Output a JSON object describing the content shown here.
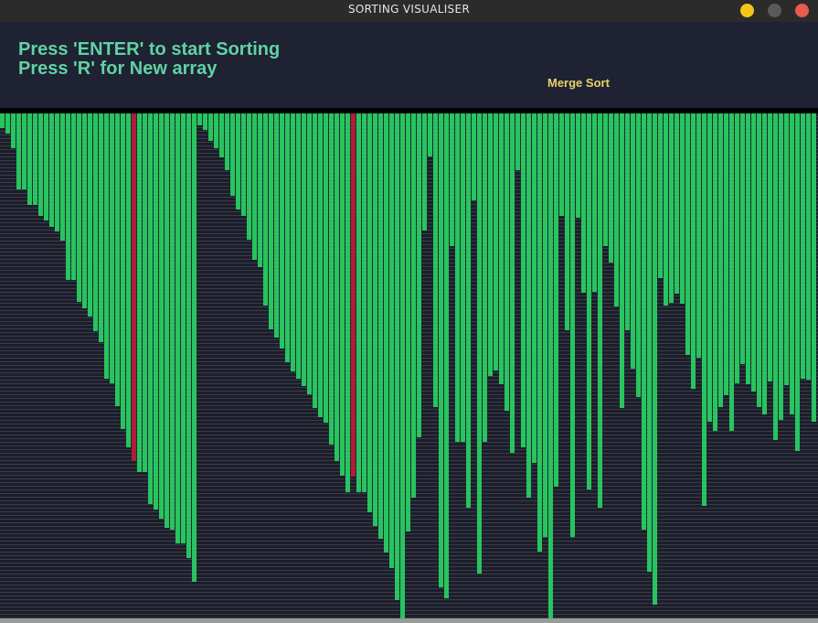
{
  "window": {
    "title": "SORTING VISUALISER",
    "buttons": [
      {
        "name": "minimize",
        "color": "#f5c518"
      },
      {
        "name": "maximize",
        "color": "#5a5a5a"
      },
      {
        "name": "close",
        "color": "#e95a4f"
      }
    ]
  },
  "header": {
    "line1": "Press 'ENTER' to start Sorting",
    "line2": "Press 'R' for New array",
    "algorithm": "Merge Sort"
  },
  "colors": {
    "instruction_text": "#5fd3a4",
    "algorithm_text": "#e8d36b",
    "bar": "#27c45f",
    "bar_active": "#b01c3a",
    "plot_background": "#1c1f2b",
    "grid_line": "#3a3d48"
  },
  "chart_data": {
    "type": "bar",
    "max_value": 552,
    "active_indices": [
      24,
      64
    ],
    "values": [
      16,
      22,
      38,
      83,
      83,
      100,
      100,
      112,
      117,
      124,
      129,
      139,
      182,
      182,
      206,
      213,
      222,
      238,
      250,
      290,
      295,
      320,
      345,
      365,
      380,
      392,
      392,
      427,
      433,
      443,
      453,
      455,
      470,
      470,
      486,
      512,
      13,
      18,
      30,
      38,
      48,
      62,
      90,
      105,
      112,
      138,
      160,
      168,
      210,
      236,
      245,
      257,
      272,
      282,
      290,
      298,
      307,
      322,
      332,
      338,
      362,
      380,
      396,
      414,
      397,
      414,
      414,
      436,
      451,
      465,
      480,
      497,
      532,
      565,
      457,
      420,
      354,
      128,
      47,
      321,
      518,
      530,
      145,
      359,
      359,
      431,
      95,
      503,
      359,
      287,
      281,
      296,
      325,
      371,
      62,
      365,
      420,
      382,
      479,
      463,
      556,
      408,
      112,
      237,
      463,
      114,
      196,
      411,
      195,
      431,
      145,
      163,
      211,
      322,
      237,
      279,
      310,
      455,
      501,
      537,
      180,
      210,
      207,
      197,
      208,
      264,
      301,
      267,
      429,
      337,
      347,
      321,
      308,
      347,
      295,
      274,
      296,
      304,
      321,
      329,
      293,
      357,
      335,
      297,
      329,
      369,
      290,
      291,
      337
    ]
  }
}
